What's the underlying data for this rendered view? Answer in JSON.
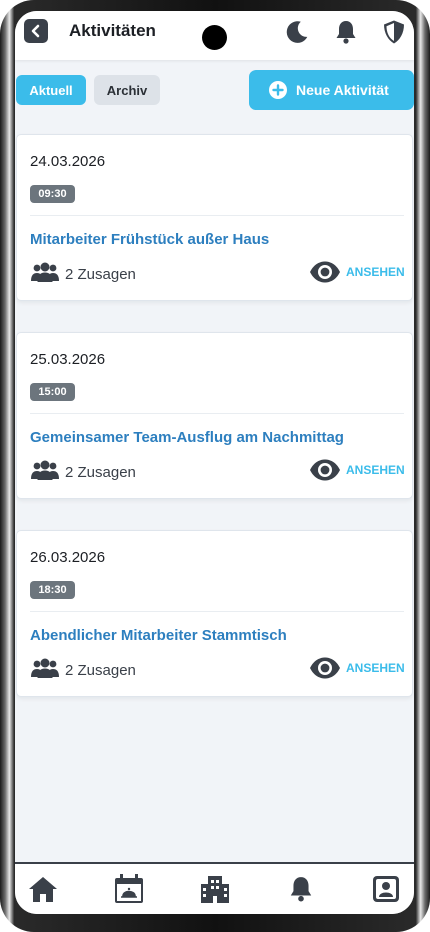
{
  "header": {
    "title": "Aktivitäten",
    "icons": [
      "back-icon",
      "moon-icon",
      "bell-icon",
      "shield-icon"
    ]
  },
  "tabs": [
    {
      "label": "Aktuell",
      "active": true
    },
    {
      "label": "Archiv",
      "active": false
    }
  ],
  "new_activity_button": {
    "label": "Neue Aktivität",
    "icon": "plus-circle-icon"
  },
  "activities": [
    {
      "date": "24.03.2026",
      "time": "09:30",
      "title": "Mitarbeiter Frühstück außer Haus",
      "participants": "2 Zusagen",
      "action": "ANSEHEN"
    },
    {
      "date": "25.03.2026",
      "time": "15:00",
      "title": "Gemeinsamer Team-Ausflug am Nachmittag",
      "participants": "2 Zusagen",
      "action": "ANSEHEN"
    },
    {
      "date": "26.03.2026",
      "time": "18:30",
      "title": "Abendlicher Mitarbeiter Stammtisch",
      "participants": "2 Zusagen",
      "action": "ANSEHEN"
    }
  ],
  "bottom_nav": [
    "home-icon",
    "calendar-event-icon",
    "building-icon",
    "bell-icon",
    "user-icon"
  ],
  "colors": {
    "accent": "#3bbcea",
    "title_link": "#2d7fbf",
    "badge": "#6c757d",
    "icon_dark": "#3a4049",
    "background": "#f1f4f8"
  }
}
